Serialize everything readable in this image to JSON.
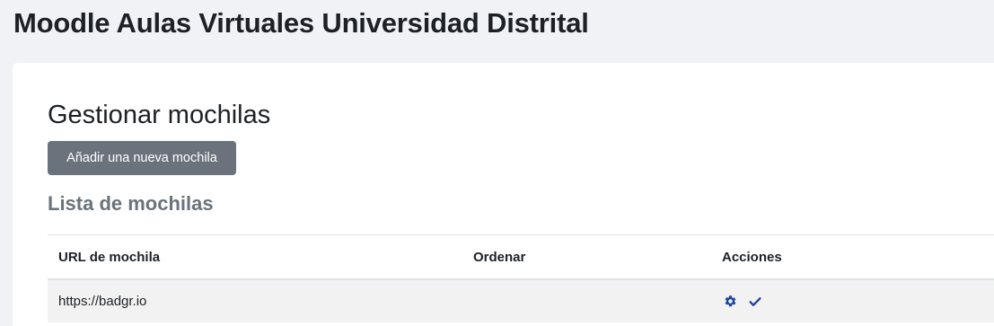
{
  "header": {
    "site_title": "Moodle Aulas Virtuales Universidad Distrital"
  },
  "main": {
    "title": "Gestionar mochilas",
    "add_button_label": "Añadir una nueva mochila",
    "section_title": "Lista de mochilas",
    "table": {
      "columns": [
        "URL de mochila",
        "Ordenar",
        "Acciones"
      ],
      "rows": [
        {
          "url": "https://badgr.io",
          "order": "",
          "actions": [
            {
              "icon": "gear-icon",
              "color": "#1f45a0"
            },
            {
              "icon": "check-icon",
              "color": "#1f45a0"
            }
          ]
        }
      ]
    }
  },
  "colors": {
    "page_background": "#f1f2f6",
    "card_background": "#ffffff",
    "button_background": "#6a737b",
    "icon_accent": "#1f45a0",
    "row_background": "#f2f2f2"
  }
}
